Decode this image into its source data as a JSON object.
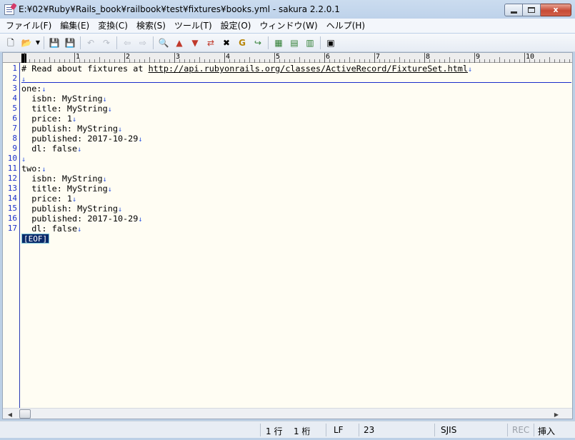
{
  "window": {
    "title": "E:¥02¥Ruby¥Rails_book¥railbook¥test¥fixtures¥books.yml - sakura 2.2.0.1",
    "close_symbol": "x"
  },
  "menu": [
    "ファイル(F)",
    "編集(E)",
    "変換(C)",
    "検索(S)",
    "ツール(T)",
    "設定(O)",
    "ウィンドウ(W)",
    "ヘルプ(H)"
  ],
  "toolbar": {
    "new": "🗋",
    "open": "📂",
    "dropdown": "▼",
    "save": "💾",
    "save_as": "💾",
    "undo": "↶",
    "redo": "↷",
    "prev": "⇦",
    "next": "⇨",
    "find": "🔍",
    "find_prev": "▲",
    "find_next": "▼",
    "replace": "⇄",
    "find_clear": "✖",
    "grep": "G",
    "tag_jump": "↪",
    "outline1": "▦",
    "outline2": "▤",
    "outline3": "▥",
    "browse": "▣"
  },
  "ruler": {
    "labels": [
      "1",
      "2",
      "3",
      "4",
      "5",
      "6",
      "7",
      "8",
      "9",
      "10"
    ]
  },
  "editor": {
    "lines": [
      {
        "num": "1",
        "text": "# Read about fixtures at ",
        "url": "http://api.rubyonrails.org/classes/ActiveRecord/FixtureSet.html",
        "nl": "↓"
      },
      {
        "num": "2",
        "text": "",
        "nl": "↓"
      },
      {
        "num": "3",
        "text": "one:",
        "nl": "↓"
      },
      {
        "num": "4",
        "text": "  isbn: MyString",
        "nl": "↓"
      },
      {
        "num": "5",
        "text": "  title: MyString",
        "nl": "↓"
      },
      {
        "num": "6",
        "text": "  price: 1",
        "nl": "↓"
      },
      {
        "num": "7",
        "text": "  publish: MyString",
        "nl": "↓"
      },
      {
        "num": "8",
        "text": "  published: 2017-10-29",
        "nl": "↓"
      },
      {
        "num": "9",
        "text": "  dl: false",
        "nl": "↓"
      },
      {
        "num": "10",
        "text": "",
        "nl": "↓"
      },
      {
        "num": "11",
        "text": "two:",
        "nl": "↓"
      },
      {
        "num": "12",
        "text": "  isbn: MyString",
        "nl": "↓"
      },
      {
        "num": "13",
        "text": "  title: MyString",
        "nl": "↓"
      },
      {
        "num": "14",
        "text": "  price: 1",
        "nl": "↓"
      },
      {
        "num": "15",
        "text": "  publish: MyString",
        "nl": "↓"
      },
      {
        "num": "16",
        "text": "  published: 2017-10-29",
        "nl": "↓"
      },
      {
        "num": "17",
        "text": "  dl: false",
        "nl": "↓"
      }
    ],
    "eof_marker": "[EOF]"
  },
  "scrollbar": {
    "left_arrow": "◀",
    "right_arrow": "▶"
  },
  "status": {
    "row": "1 行",
    "col": "1 桁",
    "eol": "LF",
    "code_point": "23",
    "encoding": "SJIS",
    "rec": "REC",
    "mode": "挿入"
  }
}
